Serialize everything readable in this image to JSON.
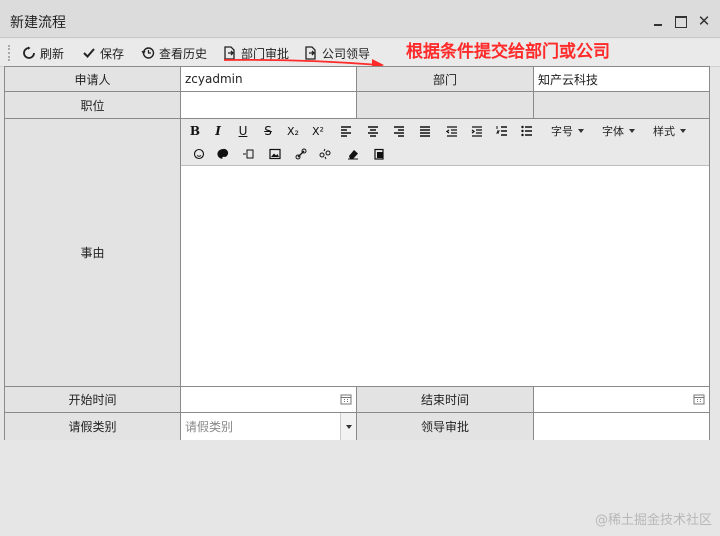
{
  "window": {
    "title": "新建流程"
  },
  "toolbar": {
    "refresh": "刷新",
    "save": "保存",
    "history": "查看历史",
    "dept_approve": "部门审批",
    "company_lead": "公司领导"
  },
  "annotation": {
    "text": "根据条件提交给部门或公司",
    "color": "#ff2a2a"
  },
  "form": {
    "applicant_label": "申请人",
    "applicant_value": "zcyadmin",
    "dept_label": "部门",
    "dept_value": "知产云科技",
    "position_label": "职位",
    "position_value": "",
    "reason_label": "事由",
    "start_label": "开始时间",
    "start_value": "",
    "end_label": "结束时间",
    "end_value": "",
    "leave_type_label": "请假类别",
    "leave_type_placeholder": "请假类别",
    "leader_label": "领导审批",
    "leader_value": ""
  },
  "editor": {
    "font_size": "字号",
    "font_family": "字体",
    "style": "样式",
    "bold": "B",
    "italic": "I",
    "underline": "U",
    "strike": "S"
  },
  "watermark": "@稀土掘金技术社区"
}
